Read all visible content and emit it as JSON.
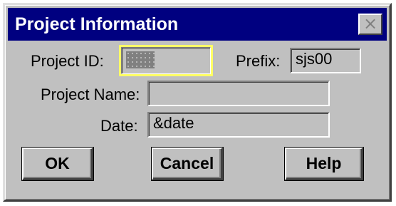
{
  "window": {
    "title": "Project Information",
    "close_glyph": "×"
  },
  "form": {
    "project_id": {
      "label": "Project ID:",
      "value": ""
    },
    "prefix": {
      "label": "Prefix:",
      "value": "sjs00"
    },
    "project_name": {
      "label": "Project Name:",
      "value": ""
    },
    "date": {
      "label": "Date:",
      "value": "&date"
    }
  },
  "buttons": {
    "ok": "OK",
    "cancel": "Cancel",
    "help": "Help"
  },
  "colors": {
    "titlebar": "#000080",
    "face": "#c0c0c0",
    "focus": "#ffff66"
  },
  "icons": {
    "close": "close-icon"
  }
}
